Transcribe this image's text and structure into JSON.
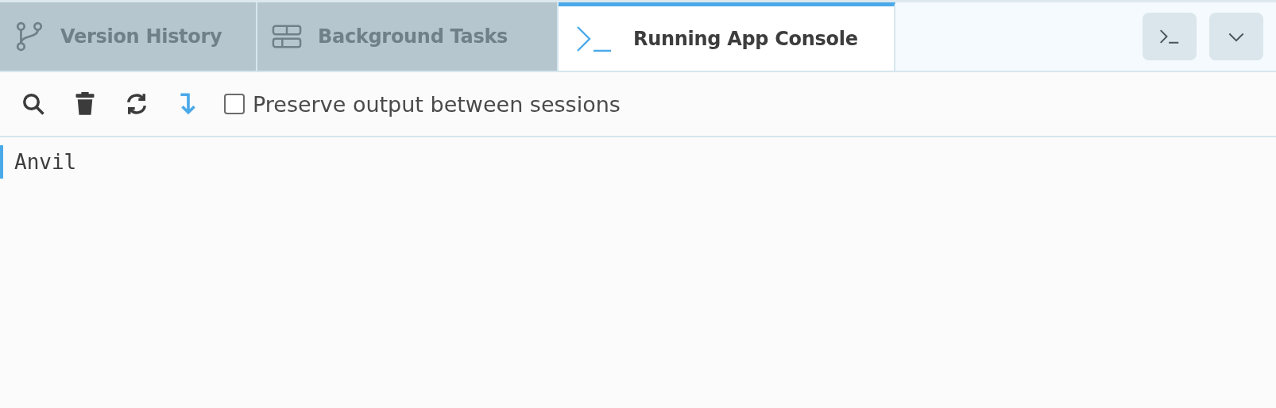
{
  "tabs": [
    {
      "label": "Version History",
      "selected": false
    },
    {
      "label": "Background Tasks",
      "selected": false
    },
    {
      "label": "Running App Console",
      "selected": true
    }
  ],
  "toolbar": {
    "preserve_output": {
      "label": "Preserve output between sessions",
      "checked": false
    }
  },
  "console": {
    "lines": [
      "Anvil"
    ]
  }
}
